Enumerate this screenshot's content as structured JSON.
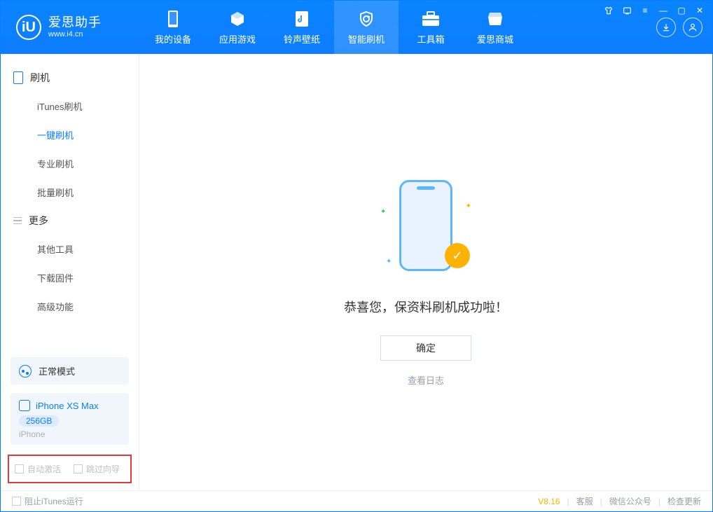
{
  "app": {
    "name_cn": "爱思助手",
    "url": "www.i4.cn"
  },
  "nav": {
    "tabs": [
      {
        "label": "我的设备"
      },
      {
        "label": "应用游戏"
      },
      {
        "label": "铃声壁纸"
      },
      {
        "label": "智能刷机"
      },
      {
        "label": "工具箱"
      },
      {
        "label": "爱思商城"
      }
    ]
  },
  "sidebar": {
    "group1_label": "刷机",
    "items1": [
      {
        "label": "iTunes刷机"
      },
      {
        "label": "一键刷机"
      },
      {
        "label": "专业刷机"
      },
      {
        "label": "批量刷机"
      }
    ],
    "group2_label": "更多",
    "items2": [
      {
        "label": "其他工具"
      },
      {
        "label": "下载固件"
      },
      {
        "label": "高级功能"
      }
    ],
    "status_label": "正常模式",
    "device": {
      "name": "iPhone XS Max",
      "capacity": "256GB",
      "type": "iPhone"
    },
    "chk_auto_activate": "自动激活",
    "chk_skip_guide": "跳过向导"
  },
  "main": {
    "success_text": "恭喜您，保资料刷机成功啦！",
    "confirm_label": "确定",
    "view_log_label": "查看日志"
  },
  "footer": {
    "block_itunes": "阻止iTunes运行",
    "version": "V8.16",
    "support": "客服",
    "wechat": "微信公众号",
    "check_update": "检查更新"
  }
}
